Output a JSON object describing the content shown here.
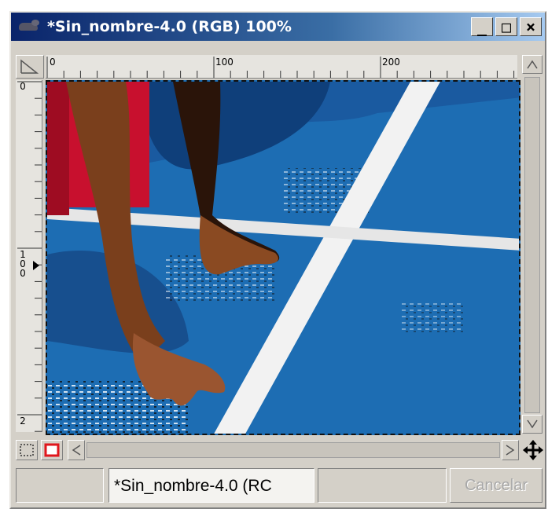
{
  "window": {
    "title": "*Sin_nombre-4.0 (RGB) 100%",
    "controls": {
      "minimize": "_",
      "maximize": "□",
      "close": "×"
    }
  },
  "ruler_top": {
    "labels": [
      "0",
      "100",
      "200"
    ]
  },
  "ruler_left": {
    "labels": [
      "0",
      "1\n0\n0",
      "2"
    ]
  },
  "statusbar": {
    "field1": "",
    "field2": "*Sin_nombre-4.0 (RC",
    "field3": "",
    "cancel_label": "Cancelar"
  },
  "colors": {
    "titlebar_start": "#0a246a",
    "titlebar_end": "#a6caf0",
    "court_blue": "#1d6db3",
    "line_white": "#f2f2f2",
    "skin": "#8a4a22",
    "shirt_red": "#c8102e",
    "quickmask_red": "#e0161c"
  },
  "icons": {
    "app": "gimp-wilber-icon",
    "quickmask_off": "quickmask-off-icon",
    "quickmask_on": "quickmask-on-icon",
    "navigate": "move-cross-icon"
  }
}
